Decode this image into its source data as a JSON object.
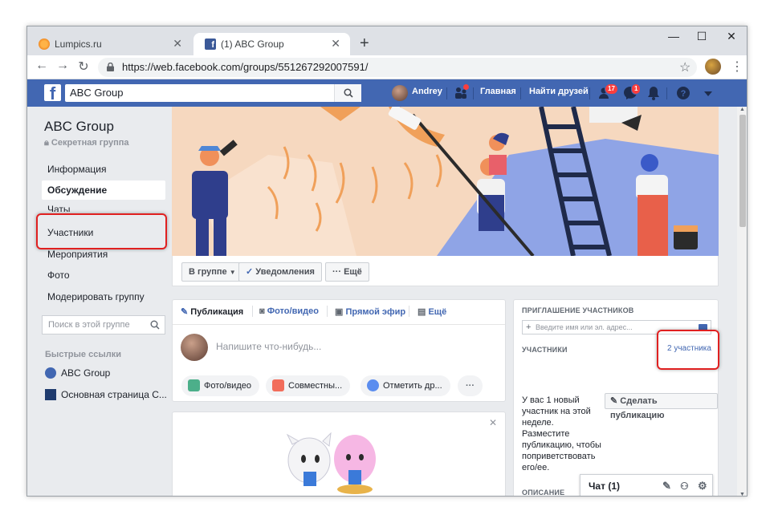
{
  "browser": {
    "tabs": [
      {
        "title": "Lumpics.ru",
        "active": false
      },
      {
        "title": "(1) ABC Group",
        "active": true
      }
    ],
    "url": "https://web.facebook.com/groups/551267292007591/"
  },
  "fb_header": {
    "search_value": "ABC Group",
    "user_name": "Andrey",
    "nav_home": "Главная",
    "nav_find_friends": "Найти друзей",
    "friend_requests_badge": "17",
    "messages_badge": "1"
  },
  "left_sidebar": {
    "group_name": "ABC Group",
    "group_type": "Секретная группа",
    "items": [
      {
        "label": "Информация"
      },
      {
        "label": "Обсуждение"
      },
      {
        "label": "Чаты"
      },
      {
        "label": "Участники"
      },
      {
        "label": "Мероприятия"
      },
      {
        "label": "Фото"
      },
      {
        "label": "Модерировать группу"
      }
    ],
    "search_placeholder": "Поиск в этой группе",
    "quick_links_title": "Быстрые ссылки",
    "quick_links": [
      {
        "label": "ABC Group"
      },
      {
        "label": "Основная страница С..."
      }
    ]
  },
  "action_bar": {
    "in_group": "В группе",
    "notifications": "Уведомления",
    "more": "Ещё"
  },
  "composer": {
    "tabs": [
      "Публикация",
      "Фото/видео",
      "Прямой эфир",
      "Ещё"
    ],
    "placeholder": "Напишите что-нибудь...",
    "chips": [
      "Фото/видео",
      "Совместны...",
      "Отметить др..."
    ]
  },
  "right_column": {
    "invite_title": "ПРИГЛАШЕНИЕ УЧАСТНИКОВ",
    "invite_placeholder": "Введите имя или эл. адрес...",
    "members_title": "УЧАСТНИКИ",
    "members_count": "2 участника",
    "new_member_text": "У вас 1 новый участник на этой неделе. Разместите публикацию, чтобы поприветствовать его/ее.",
    "make_post_button": "Сделать публикацию",
    "description_title": "ОПИСАНИЕ"
  },
  "chat": {
    "label": "Чат (1)"
  }
}
